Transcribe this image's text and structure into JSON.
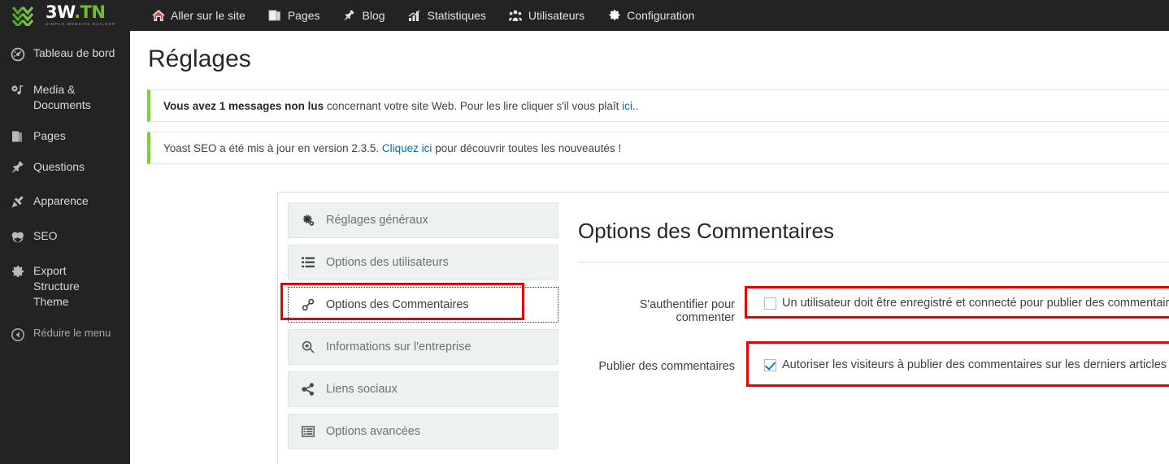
{
  "topbar": {
    "logo": {
      "main": "3W",
      "tld": ".TN",
      "tagline": "SIMPLE WEBSITE BUILDER",
      "mark": "zigzag-chevron-mark"
    },
    "nav": [
      {
        "label": "Aller sur le site",
        "icon": "home-icon"
      },
      {
        "label": "Pages",
        "icon": "book-icon"
      },
      {
        "label": "Blog",
        "icon": "pushpin-icon"
      },
      {
        "label": "Statistiques",
        "icon": "bar-chart-icon"
      },
      {
        "label": "Utilisateurs",
        "icon": "users-icon"
      },
      {
        "label": "Configuration",
        "icon": "gear-icon"
      }
    ]
  },
  "sidebar": {
    "items": [
      {
        "label": "Tableau de bord",
        "icon": "dashboard-icon"
      },
      {
        "label": "Media & Documents",
        "icon": "media-icon"
      },
      {
        "label": "Pages",
        "icon": "pages-icon"
      },
      {
        "label": "Questions",
        "icon": "pushpin-icon"
      },
      {
        "label": "Apparence",
        "icon": "paintbrush-icon"
      },
      {
        "label": "SEO",
        "icon": "seo-icon"
      },
      {
        "label": "Export Structure Theme",
        "icon": "gear-icon"
      },
      {
        "label": "Réduire le menu",
        "icon": "collapse-arrow-icon"
      }
    ]
  },
  "page": {
    "title": "Réglages"
  },
  "notices": [
    {
      "strong": "Vous avez 1 messages non lus",
      "text": " concernant votre site Web. Pour les lire cliquer s'il vous plaît ",
      "link": "ici.",
      "after": ".",
      "accent": "#7ad03a"
    },
    {
      "strong": "",
      "text": "Yoast SEO a été mis à jour en version 2.3.5. ",
      "link": "Cliquez ici",
      "after": " pour découvrir toutes les nouveautés !",
      "accent": "#7ad03a"
    }
  ],
  "settings": {
    "tabs": [
      {
        "label": "Réglages généraux",
        "icon": "gears-icon",
        "active": false
      },
      {
        "label": "Options des utilisateurs",
        "icon": "list-icon",
        "active": false
      },
      {
        "label": "Options des Commentaires",
        "icon": "link-chain-icon",
        "active": true
      },
      {
        "label": "Informations sur l'entreprise",
        "icon": "magnifier-plus-icon",
        "active": false
      },
      {
        "label": "Liens sociaux",
        "icon": "share-icon",
        "active": false
      },
      {
        "label": "Options avancées",
        "icon": "list-alt-icon",
        "active": false
      }
    ],
    "panel": {
      "title": "Options des Commentaires",
      "rows": [
        {
          "label": "S'authentifier pour commenter",
          "checkbox_label": "Un utilisateur doit être enregistré et connecté pour publier des commentaires",
          "checked": false
        },
        {
          "label": "Publier des commentaires",
          "checkbox_label": "Autoriser les visiteurs à publier des commentaires sur les derniers articles",
          "checked": true
        }
      ]
    }
  },
  "annotations": {
    "highlight_color": "#e60000"
  }
}
